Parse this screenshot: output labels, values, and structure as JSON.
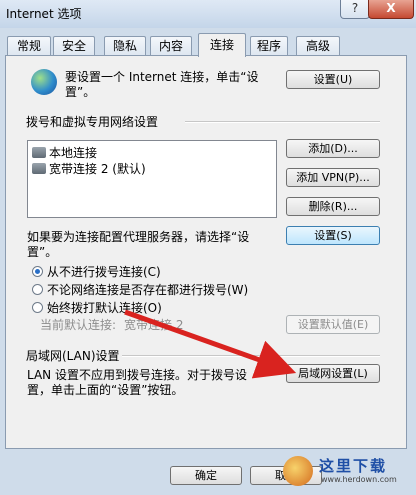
{
  "window": {
    "title": "Internet 选项",
    "help_label": "?",
    "close_label": "X"
  },
  "tabs": [
    {
      "label": "常规"
    },
    {
      "label": "安全"
    },
    {
      "label": "隐私"
    },
    {
      "label": "内容"
    },
    {
      "label": "连接"
    },
    {
      "label": "程序"
    },
    {
      "label": "高级"
    }
  ],
  "active_tab": "连接",
  "setup": {
    "text_line1": "要设置一个 Internet 连接，单击“设",
    "text_line2": "置”。",
    "button": "设置(U)"
  },
  "dialup": {
    "section_title": "拨号和虚拟专用网络设置",
    "connections": [
      {
        "name": "本地连接"
      },
      {
        "name": "宽带连接 2 (默认)"
      }
    ],
    "add_button": "添加(D)...",
    "add_vpn_button": "添加 VPN(P)...",
    "delete_button": "删除(R)...",
    "proxy_text_line1": "如果要为连接配置代理服务器，请选择“设",
    "proxy_text_line2": "置”。",
    "settings_button": "设置(S)",
    "options": [
      {
        "label": "从不进行拨号连接(C)",
        "selected": true
      },
      {
        "label": "不论网络连接是否存在都进行拨号(W)",
        "selected": false
      },
      {
        "label": "始终拨打默认连接(O)",
        "selected": false
      }
    ],
    "current_default_label": "当前默认连接:",
    "current_default_value": "宽带连接 2",
    "set_default_button": "设置默认值(E)"
  },
  "lan": {
    "section_title": "局域网(LAN)设置",
    "text_line1": "LAN 设置不应用到拨号连接。对于拨号设",
    "text_line2": "置，单击上面的“设置”按钮。",
    "button": "局域网设置(L)"
  },
  "footer": {
    "ok_button": "确定",
    "cancel_button": "取消"
  },
  "watermark": {
    "brand": "这里下载",
    "url": "www.herdown.com"
  },
  "colors": {
    "annotation_arrow": "#d9231f",
    "focus_border": "#3c7fb1"
  }
}
